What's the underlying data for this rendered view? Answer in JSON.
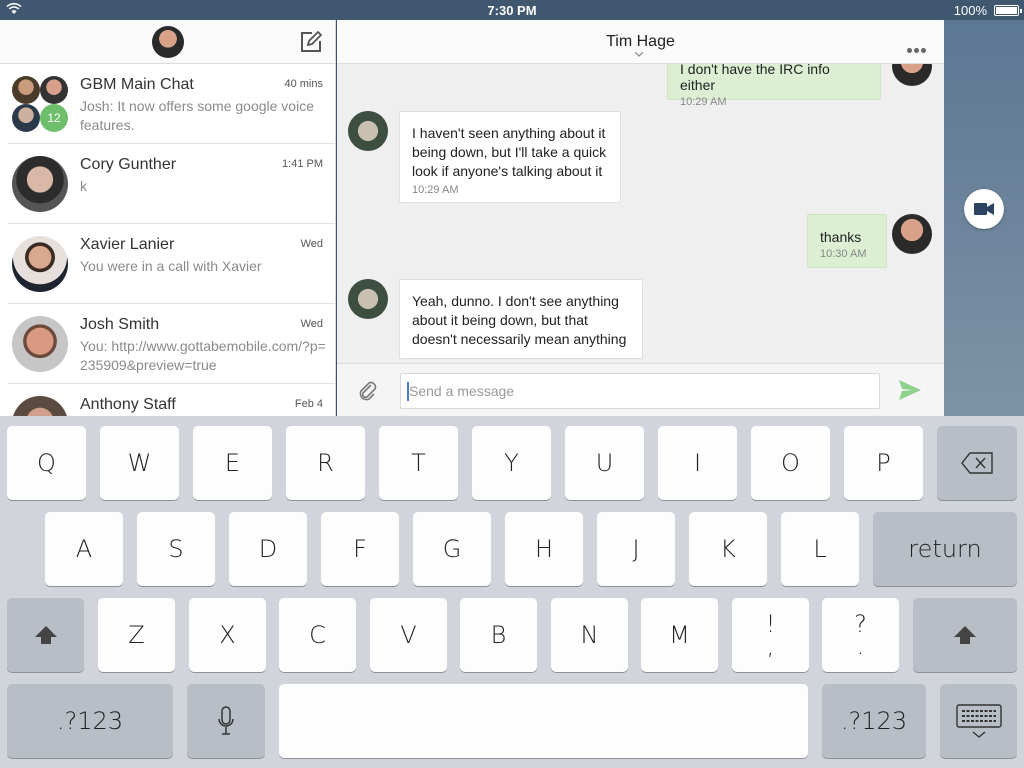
{
  "status_bar": {
    "time": "7:30 PM",
    "battery": "100%"
  },
  "sidebar": {
    "conversations": [
      {
        "name": "GBM Main Chat",
        "time": "40 mins",
        "snippet": "Josh: It now offers some google voice features.",
        "badge": "12"
      },
      {
        "name": "Cory Gunther",
        "time": "1:41 PM",
        "snippet": "k"
      },
      {
        "name": "Xavier Lanier",
        "time": "Wed",
        "snippet": "You were in a call with Xavier"
      },
      {
        "name": "Josh Smith",
        "time": "Wed",
        "snippet": "You: http://www.gottabemobile.com/?p=235909&preview=true"
      },
      {
        "name": "Anthony Staff",
        "time": "Feb 4",
        "snippet": ""
      }
    ]
  },
  "chat": {
    "title": "Tim Hage",
    "messages": [
      {
        "direction": "out",
        "text": "I don't have the IRC info either",
        "time": "10:29 AM"
      },
      {
        "direction": "in",
        "text": "I haven't seen anything about it being down, but I'll take a quick look if anyone's talking about it",
        "time": "10:29 AM"
      },
      {
        "direction": "out",
        "text": "thanks",
        "time": "10:30 AM"
      },
      {
        "direction": "in",
        "text": "Yeah, dunno. I don't see anything about it being down, but that doesn't necessarily mean anything",
        "time": ""
      }
    ],
    "composer": {
      "placeholder": "Send a message",
      "value": ""
    }
  },
  "keyboard": {
    "row1": [
      "Q",
      "W",
      "E",
      "R",
      "T",
      "Y",
      "U",
      "I",
      "O",
      "P"
    ],
    "row2": [
      "A",
      "S",
      "D",
      "F",
      "G",
      "H",
      "J",
      "K",
      "L"
    ],
    "row3": [
      "Z",
      "X",
      "C",
      "V",
      "B",
      "N",
      "M"
    ],
    "return_label": "return",
    "numbers_label": ".?123",
    "punct1": [
      "!",
      ","
    ],
    "punct2": [
      "?",
      "."
    ]
  },
  "colors": {
    "accent_green": "#6fbe6b",
    "outgoing_bubble": "#dcefd2",
    "keyboard_bg": "#d1d5db"
  },
  "icons": [
    "wifi-icon",
    "battery-icon",
    "compose-icon",
    "more-icon",
    "video-call-icon",
    "attach-icon",
    "send-icon",
    "delete-icon",
    "shift-icon",
    "mic-icon",
    "keyboard-dismiss-icon"
  ]
}
